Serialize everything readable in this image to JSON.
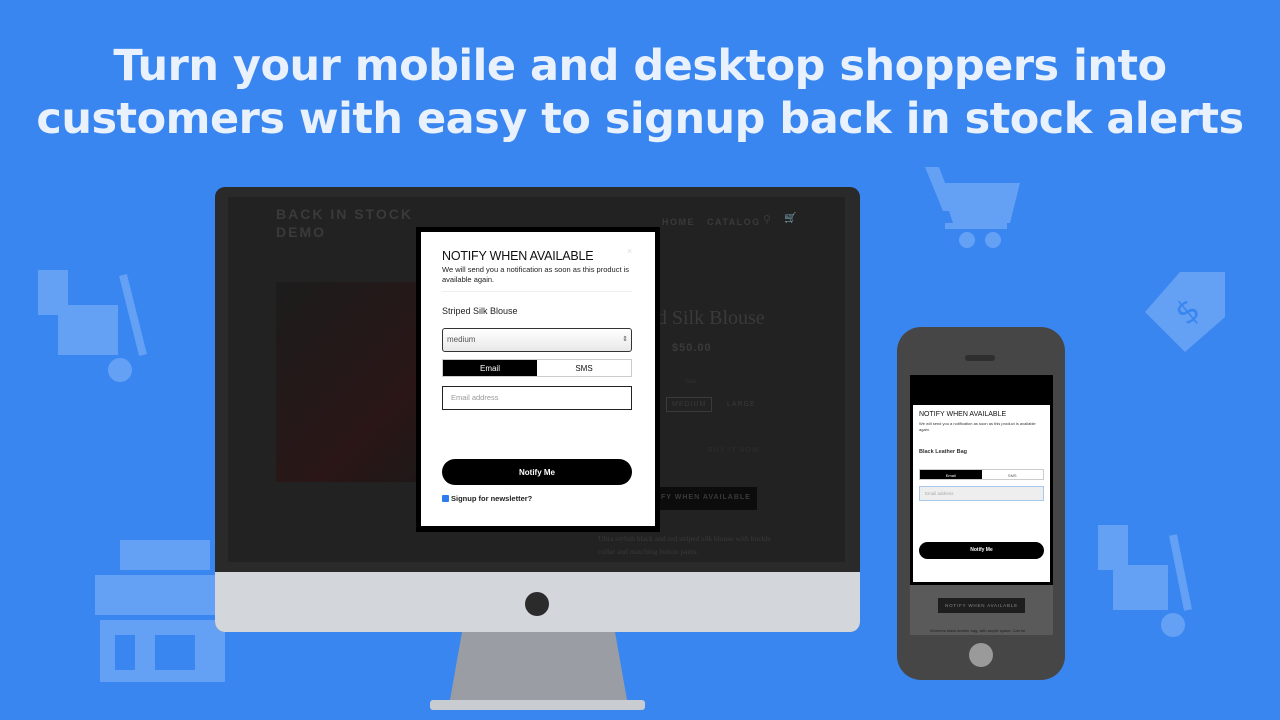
{
  "headline": {
    "line1": "Turn your mobile and desktop shoppers into",
    "line2": "customers with easy to signup back in stock alerts"
  },
  "colors": {
    "background": "#3a86f0",
    "decor": "#64a1f5"
  },
  "decor_icons": [
    "cart-icon",
    "price-tag-icon",
    "hand-truck-icon",
    "storefront-icon"
  ],
  "desktop": {
    "store_title": "BACK IN STOCK DEMO",
    "nav": [
      "HOME",
      "CATALOG"
    ],
    "nav_icons": [
      "search-icon",
      "cart-icon"
    ],
    "product_title_partial": "ed Silk Blouse",
    "price": "$50.00",
    "size_label": "Size",
    "sizes": [
      "MEDIUM",
      "LARGE"
    ],
    "buy_now": "BUY IT NOW",
    "notify_button_partial": "FY WHEN AVAILABLE",
    "description": "Ultra stylish black and red striped silk blouse with buckle collar and matching button pants.",
    "modal": {
      "title": "NOTIFY WHEN AVAILABLE",
      "subtitle": "We will send you a notification as soon as this product is available again.",
      "close": "×",
      "product": "Striped Silk Blouse",
      "variant": "medium",
      "tabs": [
        "Email",
        "SMS"
      ],
      "email_placeholder": "Email address",
      "submit": "Notify Me",
      "newsletter": "Signup for newsletter?",
      "newsletter_checked": true
    }
  },
  "mobile": {
    "modal": {
      "title": "NOTIFY WHEN AVAILABLE",
      "subtitle": "We will send you a notification as soon as this product is available again.",
      "product": "Black Leather Bag",
      "tabs": [
        "Email",
        "SMS"
      ],
      "email_placeholder": "Email address",
      "submit": "Notify Me"
    },
    "notify_button": "NOTIFY WHEN AVAILABLE",
    "description_partial": "Womens black leather bag, with ample space. Can be"
  }
}
